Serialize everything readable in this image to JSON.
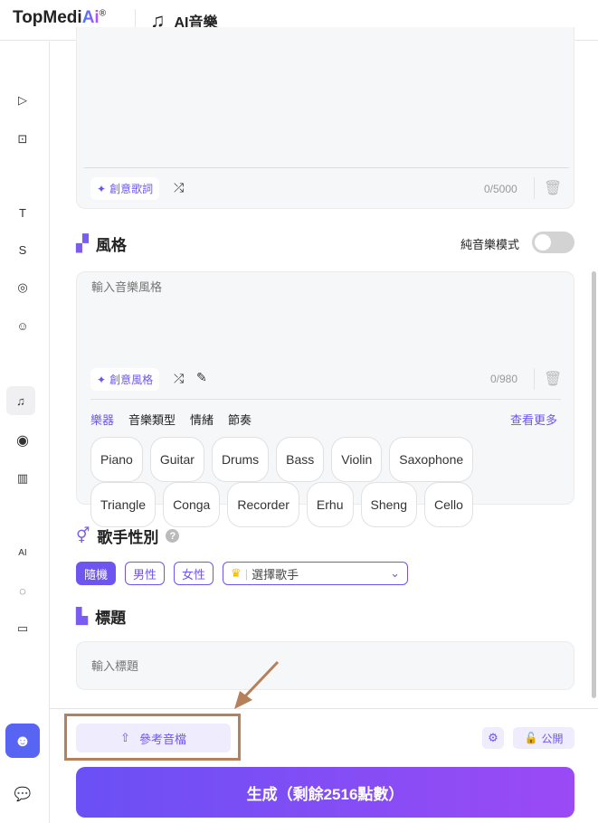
{
  "header": {
    "brand": "TopMedi",
    "brand_ai": "Ai",
    "reg": "®",
    "title": "AI音樂"
  },
  "lyrics": {
    "creative_label": "創意歌詞",
    "count": "0/5000"
  },
  "style": {
    "title": "風格",
    "instrumental_label": "純音樂模式",
    "instrumental_on": false,
    "placeholder": "輸入音樂風格",
    "creative_label": "創意風格",
    "count": "0/980",
    "categories": [
      "樂器",
      "音樂類型",
      "情緒",
      "節奏"
    ],
    "more": "查看更多",
    "tags": [
      "Piano",
      "Guitar",
      "Drums",
      "Bass",
      "Violin",
      "Saxophone",
      "Triangle",
      "Conga",
      "Recorder",
      "Erhu",
      "Sheng",
      "Cello"
    ]
  },
  "gender": {
    "title": "歌手性別",
    "options": [
      "隨機",
      "男性",
      "女性"
    ],
    "selected": "隨機",
    "singer_select": "選擇歌手"
  },
  "title_section": {
    "title": "標題",
    "placeholder": "輸入標題"
  },
  "footer": {
    "reference_audio": "參考音檔",
    "public_label": "公開",
    "generate": "生成（剩餘2516點數）"
  },
  "colors": {
    "accent": "#6e55f0",
    "annotation": "#b5805a"
  }
}
